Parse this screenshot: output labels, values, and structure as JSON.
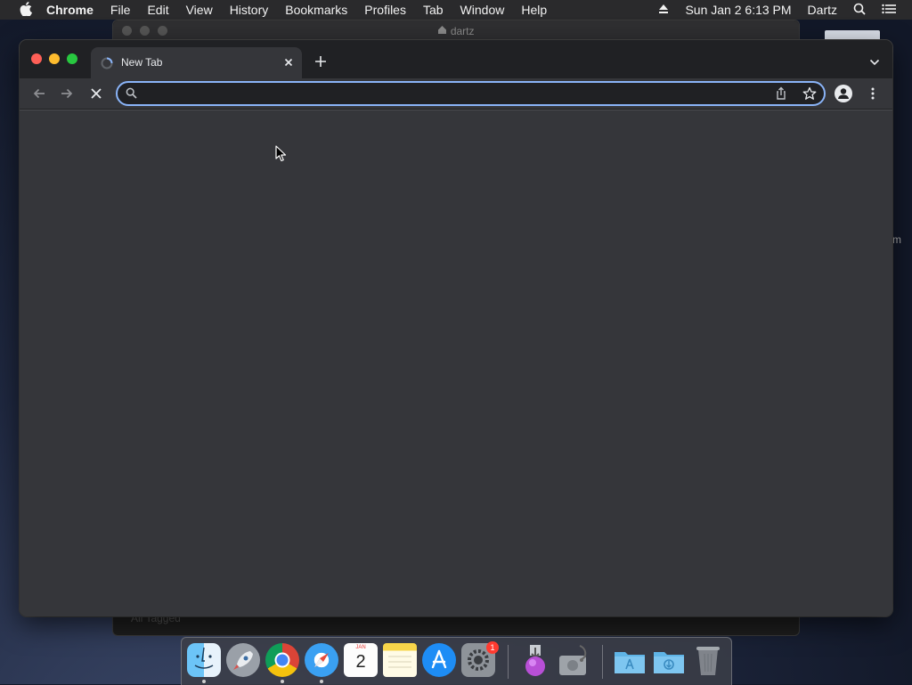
{
  "menubar": {
    "app_name": "Chrome",
    "items": [
      "File",
      "Edit",
      "View",
      "History",
      "Bookmarks",
      "Profiles",
      "Tab",
      "Window",
      "Help"
    ],
    "clock": "Sun Jan 2  6:13 PM",
    "user": "Dartz"
  },
  "background_window": {
    "title": "dartz",
    "bottom_text": "All Tagged"
  },
  "side_text": "m",
  "chrome": {
    "tab": {
      "title": "New Tab"
    },
    "omnibox": {
      "value": "",
      "placeholder": ""
    }
  },
  "dock": {
    "calendar": {
      "month": "JAN",
      "day": "2"
    },
    "system_preferences_badge": "1",
    "apps": [
      "finder",
      "launchpad",
      "chrome",
      "safari",
      "calendar",
      "notes",
      "app-store",
      "system-preferences",
      "installer",
      "disk-utility",
      "applications-folder",
      "downloads-folder",
      "trash"
    ]
  },
  "colors": {
    "accent": "#8ab4f8",
    "toolbar": "#35363a",
    "tabstrip": "#202124"
  }
}
